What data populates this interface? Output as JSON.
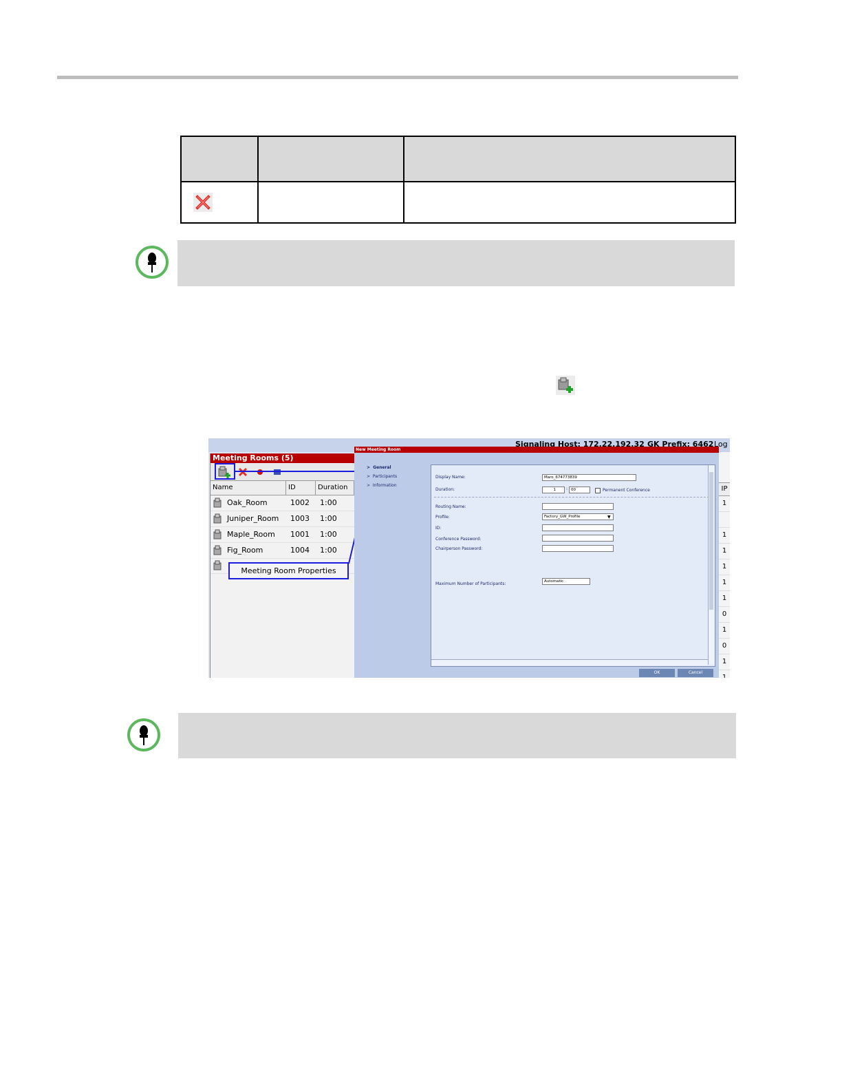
{
  "screenshot": {
    "signaling_host": "Signaling Host: 172.22.192.32",
    "gk_prefix": "GK Prefix: 6462",
    "logo_fragment": "Log",
    "meeting_rooms_title": "Meeting Rooms (5)",
    "columns": [
      "Name",
      "ID",
      "Duration"
    ],
    "rooms": [
      {
        "name": "Oak_Room",
        "id": "1002",
        "duration": "1:00"
      },
      {
        "name": "Juniper_Room",
        "id": "1003",
        "duration": "1:00"
      },
      {
        "name": "Maple_Room",
        "id": "1001",
        "duration": "1:00"
      },
      {
        "name": "Fig_Room",
        "id": "1004",
        "duration": "1:00"
      }
    ],
    "callout_label": "Meeting Room Properties",
    "dialog": {
      "title": "New Meeting Room",
      "nav": [
        "General",
        "Participants",
        "Information"
      ],
      "labels": {
        "display_name": "Display Name:",
        "duration": "Duration:",
        "permanent": "Permanent Conference",
        "routing_name": "Routing Name:",
        "profile": "Profile:",
        "id": "ID:",
        "conf_password": "Conference Password:",
        "chair_password": "Chairperson Password:",
        "max_participants": "Maximum Number of Participants:"
      },
      "values": {
        "display_name": "Maro_674773839",
        "duration_hours": "1",
        "duration_minutes": "00",
        "profile": "Factory_GW_Profile",
        "max_participants": "Automatic"
      },
      "ok": "OK",
      "cancel": "Cancel"
    },
    "right_column_header": "IP",
    "right_column_values": [
      "1",
      "",
      "1",
      "1",
      "1",
      "1",
      "1",
      "0",
      "1",
      "0",
      "1",
      "1"
    ]
  }
}
